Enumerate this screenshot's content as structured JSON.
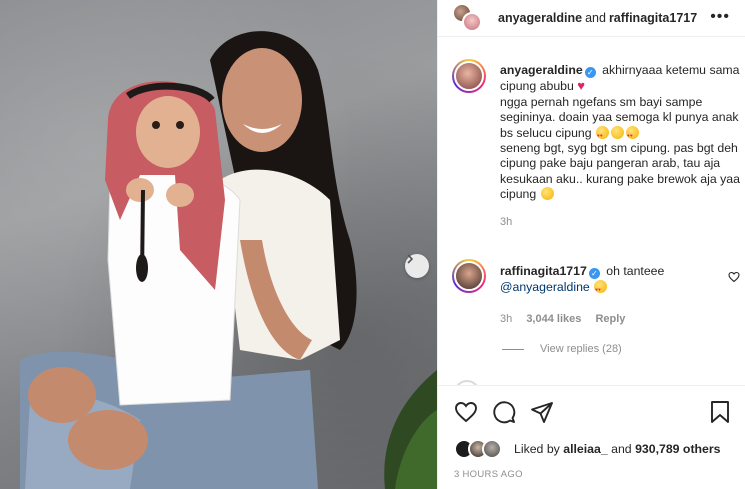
{
  "header": {
    "user1": "anyageraldine",
    "joiner": "and",
    "user2": "raffinagita1717",
    "more_icon": "more-horizontal-icon"
  },
  "caption": {
    "username": "anyageraldine",
    "verified": true,
    "line1": "akhirnyaaa ketemu sama cipung abubu",
    "line2": "ngga pernah ngefans sm bayi sampe segininya. doain yaa semoga kl punya anak bs selucu cipung",
    "line3": "seneng bgt, syg bgt sm cipung. pas bgt deh cipung pake baju pangeran arab, tau aja kesukaan aku.. kurang pake brewok aja yaa cipung",
    "time": "3h"
  },
  "comment": {
    "username": "raffinagita1717",
    "verified": true,
    "text": "oh tanteee",
    "mention": "@anyageraldine",
    "time": "3h",
    "likes": "3,044 likes",
    "reply_label": "Reply",
    "view_replies": "View replies (28)"
  },
  "actions": {
    "icons": [
      "heart-icon",
      "comment-icon",
      "share-icon",
      "bookmark-icon"
    ],
    "liked_by_prefix": "Liked by",
    "liked_by_user": "alleiaa_",
    "liked_by_and": "and",
    "liked_by_count": "930,789 others",
    "posted_ago": "3 HOURS AGO"
  },
  "colors": {
    "link": "#00376b",
    "meta": "#8e8e8e",
    "verified": "#3897f0",
    "heart": "#e0245e"
  }
}
